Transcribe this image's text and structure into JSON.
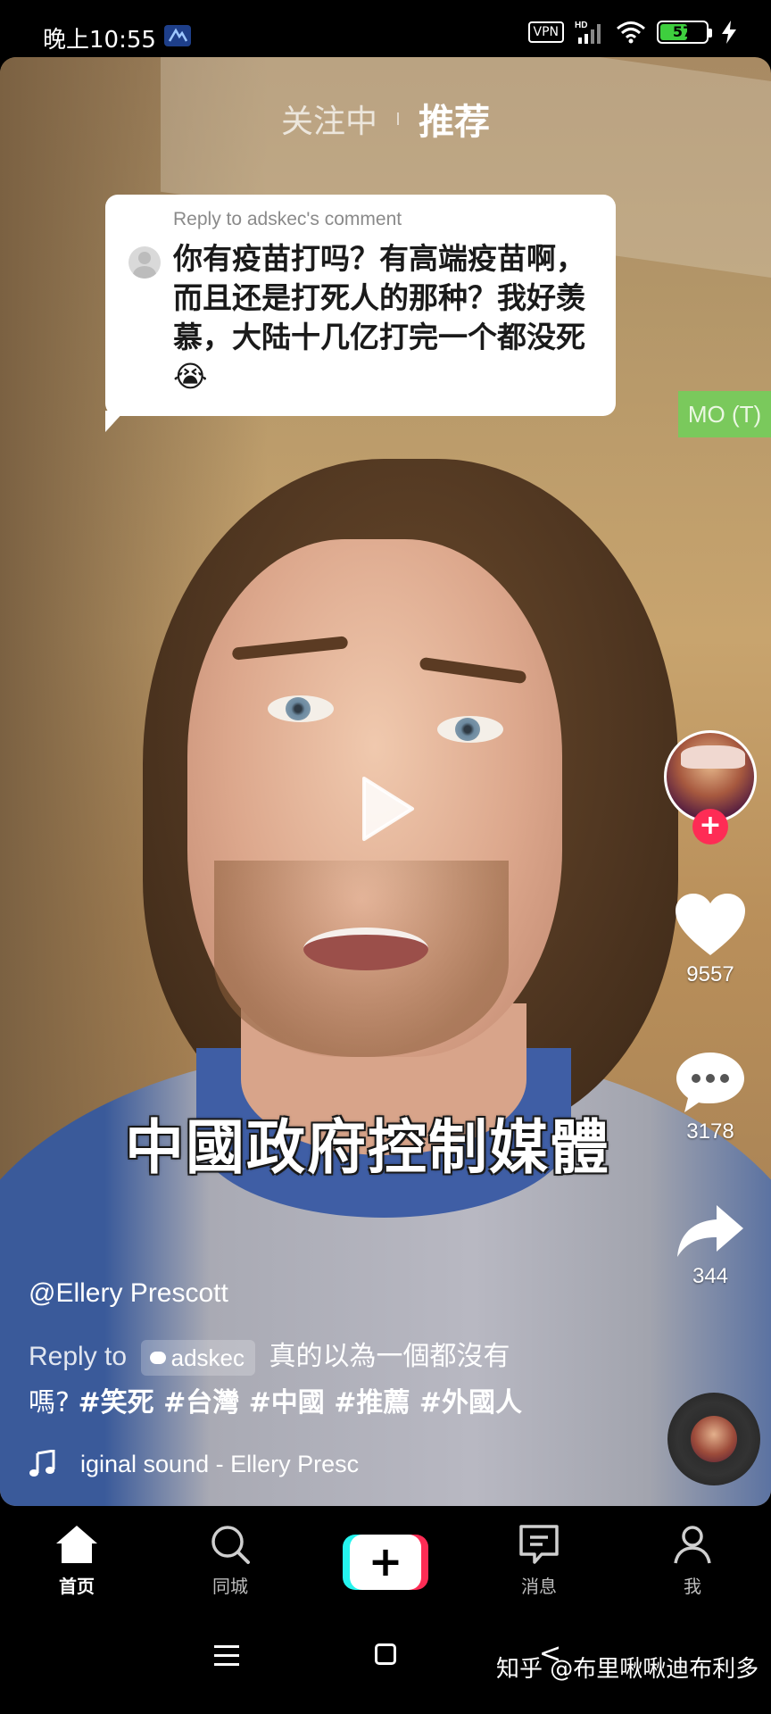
{
  "status_bar": {
    "time": "晚上10:55",
    "vpn": "VPN",
    "hd": "HD",
    "battery": "57"
  },
  "top_tabs": {
    "following": "关注中",
    "recommended": "推荐"
  },
  "reply_bubble": {
    "header": "Reply to adskec's comment",
    "text": "你有疫苗打吗？有高端疫苗啊，而且还是打死人的那种？我好羡慕，大陆十几亿打完一个都没死😭"
  },
  "mo_tag": "MO (T)",
  "subtitle": "中國政府控制媒體",
  "actions": {
    "likes": "9557",
    "comments": "3178",
    "shares": "344"
  },
  "post": {
    "username": "@Ellery Prescott",
    "reply_prefix": "Reply to",
    "reply_user": "adskec",
    "caption_text_1": "真的以為一個都沒有",
    "caption_text_2": "嗎?",
    "hashtags": "#笑死 #台灣 #中國 #推薦 #外國人",
    "sound": "iginal sound - Ellery Presc"
  },
  "bottom_nav": {
    "home": "首页",
    "nearby": "同城",
    "create": "+",
    "inbox": "消息",
    "me": "我"
  },
  "watermark": "知乎 @布里啾啾迪布利多",
  "colors": {
    "accent_red": "#fe2c55",
    "accent_cyan": "#25f4ee",
    "tag_green": "#7ac95c"
  },
  "icons": {
    "status_app": "app-notification-icon",
    "signal": "signal-icon",
    "wifi": "wifi-icon",
    "battery": "battery-icon",
    "charging": "charging-icon",
    "play": "play-icon",
    "like": "heart-icon",
    "comment": "comment-icon",
    "share": "share-icon",
    "music": "music-note-icon",
    "home": "home-icon",
    "search": "search-icon",
    "inbox": "message-icon",
    "me": "profile-icon"
  }
}
